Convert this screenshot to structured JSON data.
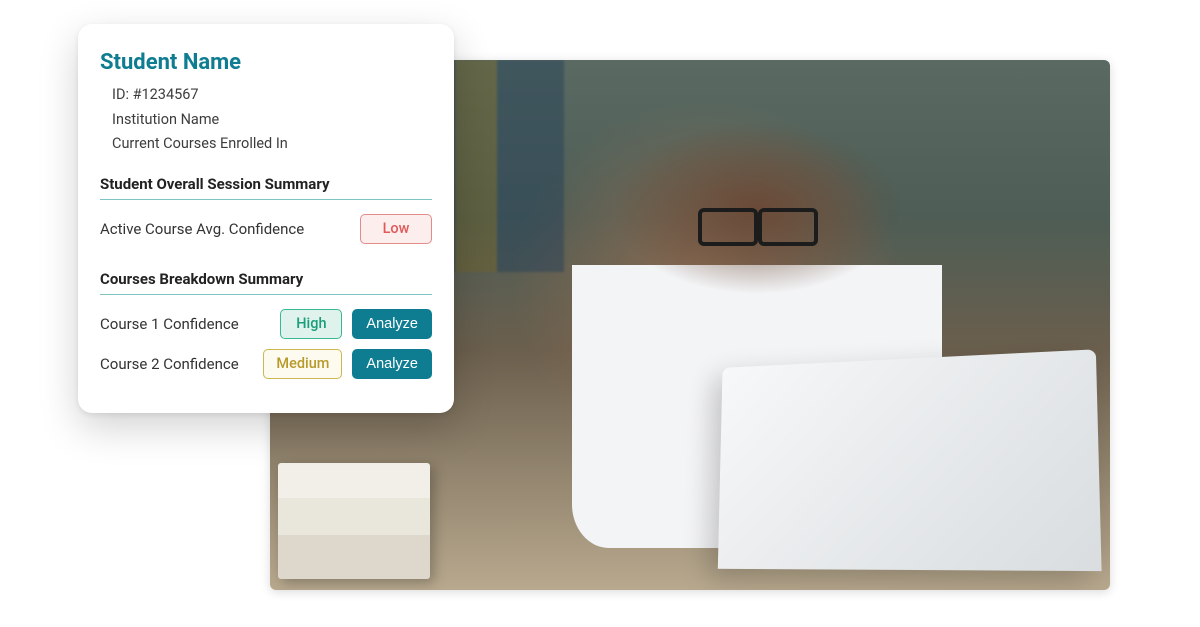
{
  "colors": {
    "accent": "#0f7d91",
    "rule": "#7fc4c4",
    "badge_low_fg": "#e05a5a",
    "badge_high_fg": "#1a9e7e",
    "badge_medium_fg": "#b89a2b"
  },
  "card": {
    "title": "Student Name",
    "id_line": "ID: #1234567",
    "institution_line": "Institution Name",
    "courses_line": "Current Courses Enrolled In",
    "overall_heading": "Student Overall Session Summary",
    "overall_row_label": "Active Course Avg. Confidence",
    "overall_badge": "Low",
    "breakdown_heading": "Courses Breakdown Summary",
    "courses": [
      {
        "label": "Course 1 Confidence",
        "badge": "High",
        "badge_level": "high",
        "action": "Analyze"
      },
      {
        "label": "Course 2 Confidence",
        "badge": "Medium",
        "badge_level": "medium",
        "action": "Analyze"
      }
    ]
  }
}
